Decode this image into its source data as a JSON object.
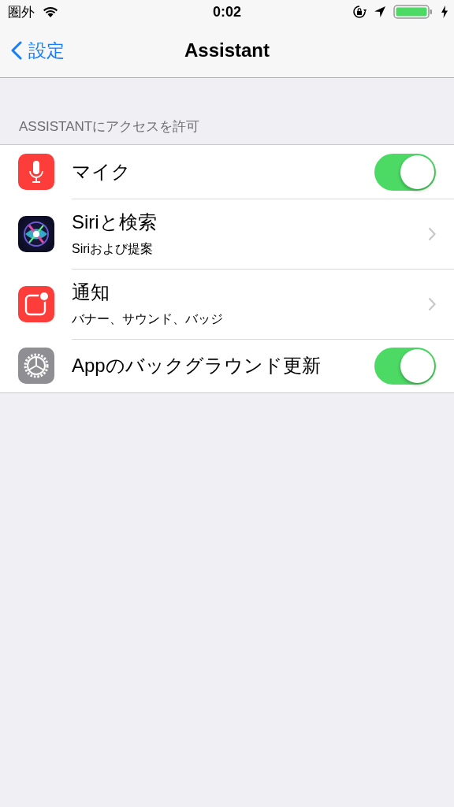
{
  "status_bar": {
    "carrier": "圏外",
    "time": "0:02"
  },
  "nav": {
    "back": "設定",
    "title": "Assistant"
  },
  "section": {
    "header": "ASSISTANTにアクセスを許可",
    "rows": [
      {
        "kind": "toggle",
        "title": "マイク",
        "on": true
      },
      {
        "kind": "link",
        "title": "Siriと検索",
        "subtitle": "Siriおよび提案"
      },
      {
        "kind": "link",
        "title": "通知",
        "subtitle": "バナー、サウンド、バッジ"
      },
      {
        "kind": "toggle",
        "title": "Appのバックグラウンド更新",
        "on": true
      }
    ]
  }
}
